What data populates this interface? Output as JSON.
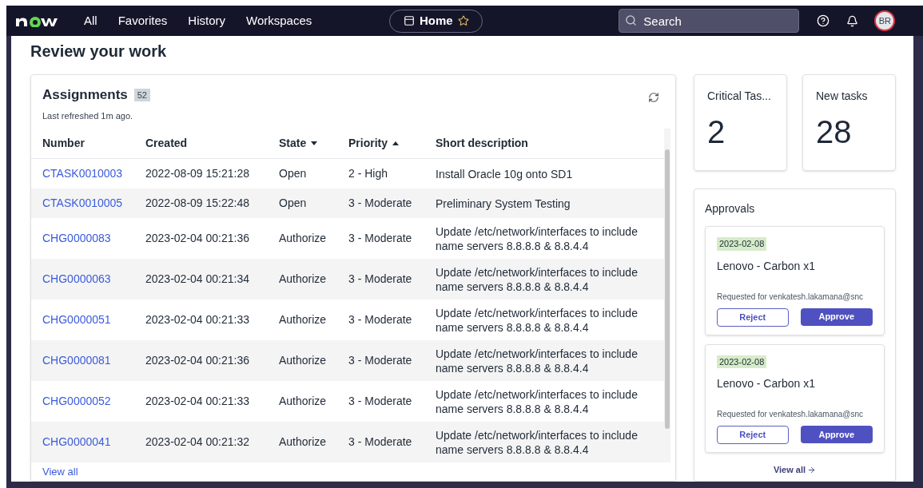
{
  "nav": {
    "menu": [
      {
        "label": "All"
      },
      {
        "label": "Favorites"
      },
      {
        "label": "History"
      },
      {
        "label": "Workspaces"
      }
    ],
    "home_tab": {
      "label": "Home",
      "starred": false
    },
    "search": {
      "placeholder": "Search"
    },
    "avatar": {
      "initials": "BR"
    }
  },
  "page_title": "Review your work",
  "assignments": {
    "title": "Assignments",
    "count": "52",
    "refreshed": "Last refreshed 1m ago.",
    "columns": [
      {
        "label": "Number",
        "sorted_asc": false,
        "sorted_desc": false
      },
      {
        "label": "Created",
        "sorted_asc": false,
        "sorted_desc": false
      },
      {
        "label": "State",
        "sorted_asc": false,
        "sorted_desc": true
      },
      {
        "label": "Priority",
        "sorted_asc": true,
        "sorted_desc": false
      },
      {
        "label": "Short description",
        "sorted_asc": false,
        "sorted_desc": false
      }
    ],
    "rows": [
      {
        "number": "CTASK0010003",
        "created": "2022-08-09 15:21:28",
        "state": "Open",
        "priority": "2 - High",
        "description": "Install Oracle 10g onto SD1"
      },
      {
        "number": "CTASK0010005",
        "created": "2022-08-09 15:22:48",
        "state": "Open",
        "priority": "3 - Moderate",
        "description": "Preliminary System Testing"
      },
      {
        "number": "CHG0000083",
        "created": "2023-02-04 00:21:36",
        "state": "Authorize",
        "priority": "3 - Moderate",
        "description": "Update /etc/network/interfaces to include name servers 8.8.8.8 & 8.8.4.4"
      },
      {
        "number": "CHG0000063",
        "created": "2023-02-04 00:21:34",
        "state": "Authorize",
        "priority": "3 - Moderate",
        "description": "Update /etc/network/interfaces to include name servers 8.8.8.8 & 8.8.4.4"
      },
      {
        "number": "CHG0000051",
        "created": "2023-02-04 00:21:33",
        "state": "Authorize",
        "priority": "3 - Moderate",
        "description": "Update /etc/network/interfaces to include name servers 8.8.8.8 & 8.8.4.4"
      },
      {
        "number": "CHG0000081",
        "created": "2023-02-04 00:21:36",
        "state": "Authorize",
        "priority": "3 - Moderate",
        "description": "Update /etc/network/interfaces to include name servers 8.8.8.8 & 8.8.4.4"
      },
      {
        "number": "CHG0000052",
        "created": "2023-02-04 00:21:33",
        "state": "Authorize",
        "priority": "3 - Moderate",
        "description": "Update /etc/network/interfaces to include name servers 8.8.8.8 & 8.8.4.4"
      },
      {
        "number": "CHG0000041",
        "created": "2023-02-04 00:21:32",
        "state": "Authorize",
        "priority": "3 - Moderate",
        "description": "Update /etc/network/interfaces to include name servers 8.8.8.8 & 8.8.4.4"
      }
    ],
    "view_all": "View all"
  },
  "stats": [
    {
      "label": "Critical Tas...",
      "value": "2"
    },
    {
      "label": "New tasks",
      "value": "28"
    }
  ],
  "approvals": {
    "title": "Approvals",
    "items": [
      {
        "date": "2023-02-08",
        "title": "Lenovo - Carbon x1",
        "requested": "Requested for venkatesh.lakamana@snc",
        "reject": "Reject",
        "approve": "Approve"
      },
      {
        "date": "2023-02-08",
        "title": "Lenovo - Carbon x1",
        "requested": "Requested for venkatesh.lakamana@snc",
        "reject": "Reject",
        "approve": "Approve"
      }
    ],
    "view_all": "View all"
  }
}
